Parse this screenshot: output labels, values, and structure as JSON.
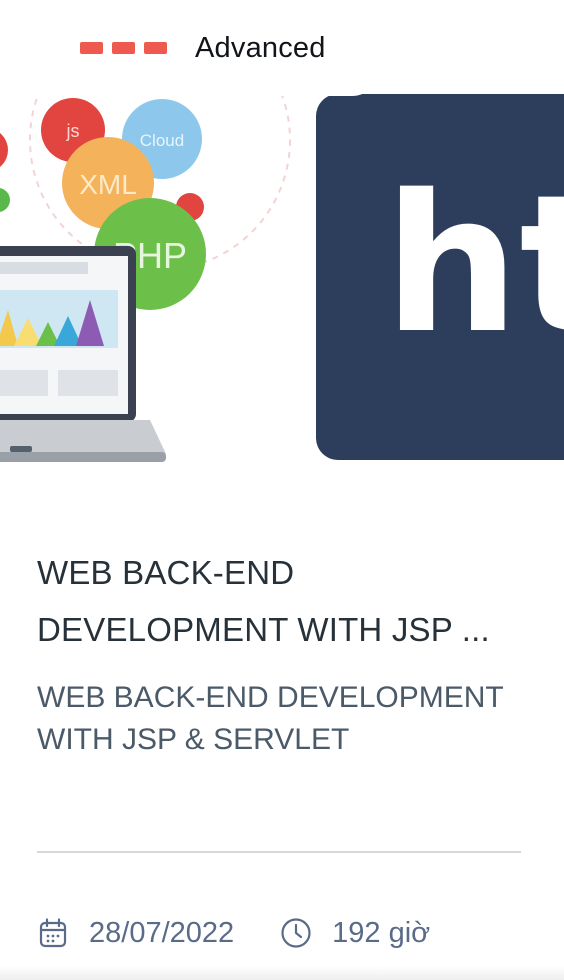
{
  "course": {
    "level": "Advanced",
    "title": "WEB BACK-END DEVELOPMENT WITH JSP ...",
    "subtitle": "WEB BACK-END DEVELOPMENT WITH JSP & SERVLET",
    "date": "28/07/2022",
    "duration": "192 giờ"
  },
  "thumbnail": {
    "bubbles": [
      "js",
      "Cloud",
      "XML",
      "PHP"
    ],
    "logo_text": "ht"
  },
  "icons": {
    "level": "level-bars-icon",
    "date": "calendar-icon",
    "duration": "clock-icon"
  },
  "colors": {
    "level_bar": "#ee5a4f",
    "title": "#27313a",
    "subtitle": "#4b5a69",
    "meta": "#5a6b8a",
    "logo_bg": "#2c3e5c"
  }
}
